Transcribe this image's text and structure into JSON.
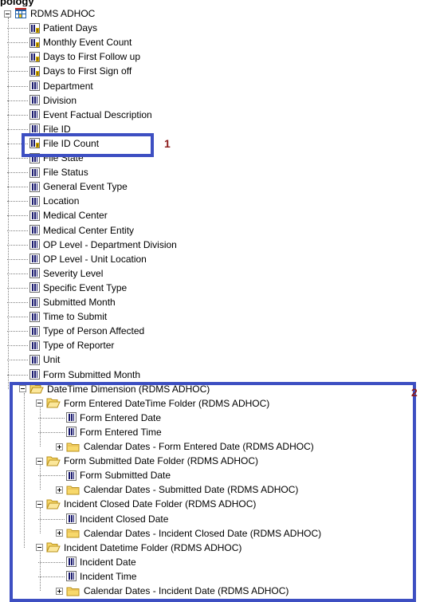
{
  "header_fragment": "pology",
  "root": {
    "label": "RDMS ADHOC",
    "icon": "cube-icon",
    "expanded": true
  },
  "measures": [
    {
      "label": "Patient Days",
      "icon": "measure-icon"
    },
    {
      "label": "Monthly Event Count",
      "icon": "measure-icon"
    },
    {
      "label": "Days to First Follow up",
      "icon": "measure-icon"
    },
    {
      "label": "Days to First Sign off",
      "icon": "measure-icon"
    }
  ],
  "attributes": [
    {
      "label": "Department",
      "icon": "attribute-icon"
    },
    {
      "label": "Division",
      "icon": "attribute-icon"
    },
    {
      "label": "Event Factual Description",
      "icon": "attribute-icon"
    },
    {
      "label": "File ID",
      "icon": "attribute-icon"
    },
    {
      "label": "File ID Count",
      "icon": "measure-icon"
    },
    {
      "label": "File State",
      "icon": "attribute-icon"
    },
    {
      "label": "File Status",
      "icon": "attribute-icon"
    },
    {
      "label": "General Event Type",
      "icon": "attribute-icon"
    },
    {
      "label": "Location",
      "icon": "attribute-icon"
    },
    {
      "label": "Medical Center",
      "icon": "attribute-icon"
    },
    {
      "label": "Medical Center Entity",
      "icon": "attribute-icon"
    },
    {
      "label": "OP Level - Department Division",
      "icon": "attribute-icon"
    },
    {
      "label": "OP Level - Unit Location",
      "icon": "attribute-icon"
    },
    {
      "label": "Severity Level",
      "icon": "attribute-icon"
    },
    {
      "label": "Specific Event Type",
      "icon": "attribute-icon"
    },
    {
      "label": "Submitted Month",
      "icon": "attribute-icon"
    },
    {
      "label": "Time to Submit",
      "icon": "attribute-icon"
    },
    {
      "label": "Type of Person Affected",
      "icon": "attribute-icon"
    },
    {
      "label": "Type of Reporter",
      "icon": "attribute-icon"
    },
    {
      "label": "Unit",
      "icon": "attribute-icon"
    },
    {
      "label": "Form Submitted Month",
      "icon": "attribute-icon"
    }
  ],
  "datetime_dimension": {
    "label": "DateTime Dimension (RDMS ADHOC)",
    "icon": "folder-open-icon",
    "folders": [
      {
        "label": "Form Entered DateTime Folder (RDMS ADHOC)",
        "items": [
          "Form Entered Date",
          "Form Entered Time"
        ],
        "calendar": "Calendar Dates - Form Entered Date (RDMS ADHOC)"
      },
      {
        "label": "Form Submitted Date Folder (RDMS ADHOC)",
        "items": [
          "Form Submitted Date"
        ],
        "calendar": "Calendar Dates - Submitted Date (RDMS ADHOC)"
      },
      {
        "label": "Incident Closed Date Folder (RDMS ADHOC)",
        "items": [
          "Incident Closed Date"
        ],
        "calendar": "Calendar Dates - Incident Closed Date (RDMS ADHOC)"
      },
      {
        "label": "Incident Datetime Folder (RDMS ADHOC)",
        "items": [
          "Incident Date",
          "Incident Time"
        ],
        "calendar": "Calendar Dates - Incident Date (RDMS ADHOC)"
      }
    ]
  },
  "annotations": [
    {
      "number": "1",
      "color": "#8b1a1a",
      "box_color": "#3d4fc2"
    },
    {
      "number": "2",
      "color": "#8b1a1a",
      "box_color": "#3d4fc2"
    }
  ]
}
